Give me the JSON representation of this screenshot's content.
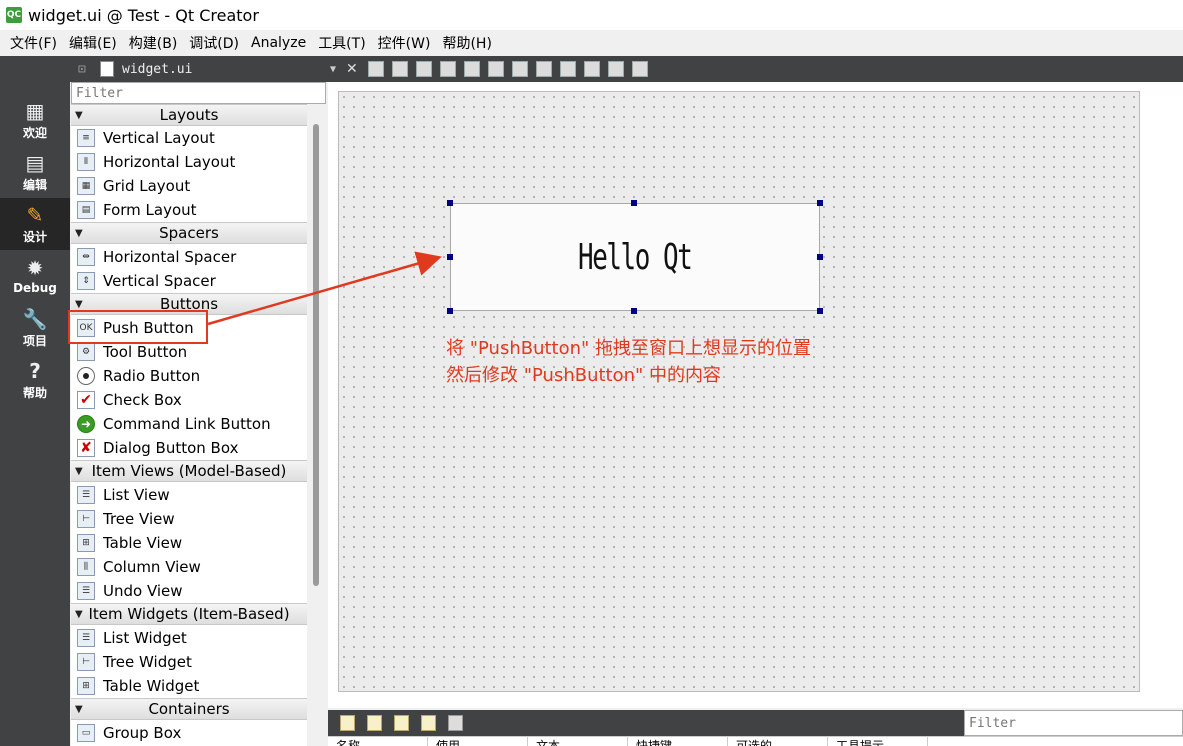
{
  "window": {
    "title": "widget.ui @ Test - Qt Creator",
    "logo_text": "QC"
  },
  "menu": [
    "文件(F)",
    "编辑(E)",
    "构建(B)",
    "调试(D)",
    "Analyze",
    "工具(T)",
    "控件(W)",
    "帮助(H)"
  ],
  "modes": [
    {
      "label": "欢迎",
      "icon": "grid-icon",
      "glyph": "▦"
    },
    {
      "label": "编辑",
      "icon": "edit-icon",
      "glyph": "▤"
    },
    {
      "label": "设计",
      "icon": "pencil-icon",
      "glyph": "✎"
    },
    {
      "label": "Debug",
      "icon": "bug-icon",
      "glyph": "✹"
    },
    {
      "label": "项目",
      "icon": "wrench-icon",
      "glyph": "🔧"
    },
    {
      "label": "帮助",
      "icon": "help-icon",
      "glyph": "?"
    }
  ],
  "editor": {
    "file": "widget.ui"
  },
  "widgetbox": {
    "filter_placeholder": "Filter",
    "categories": [
      {
        "name": "Layouts",
        "items": [
          "Vertical Layout",
          "Horizontal Layout",
          "Grid Layout",
          "Form Layout"
        ]
      },
      {
        "name": "Spacers",
        "items": [
          "Horizontal Spacer",
          "Vertical Spacer"
        ]
      },
      {
        "name": "Buttons",
        "items": [
          "Push Button",
          "Tool Button",
          "Radio Button",
          "Check Box",
          "Command Link Button",
          "Dialog Button Box"
        ]
      },
      {
        "name": "Item Views (Model-Based)",
        "items": [
          "List View",
          "Tree View",
          "Table View",
          "Column View",
          "Undo View"
        ]
      },
      {
        "name": "Item Widgets (Item-Based)",
        "items": [
          "List Widget",
          "Tree Widget",
          "Table Widget"
        ]
      },
      {
        "name": "Containers",
        "items": [
          "Group Box"
        ]
      }
    ],
    "push_button_icon_text": "OK"
  },
  "form": {
    "button_text": "Hello Qt"
  },
  "annotation": {
    "line1": "将 \"PushButton\" 拖拽至窗口上想显示的位置",
    "line2": "然后修改 \"PushButton\" 中的内容",
    "color": "#e03a1e"
  },
  "bottom": {
    "filter_placeholder": "Filter",
    "columns": [
      "名称",
      "使用",
      "文本",
      "快捷键",
      "可选的",
      "工具提示"
    ]
  }
}
